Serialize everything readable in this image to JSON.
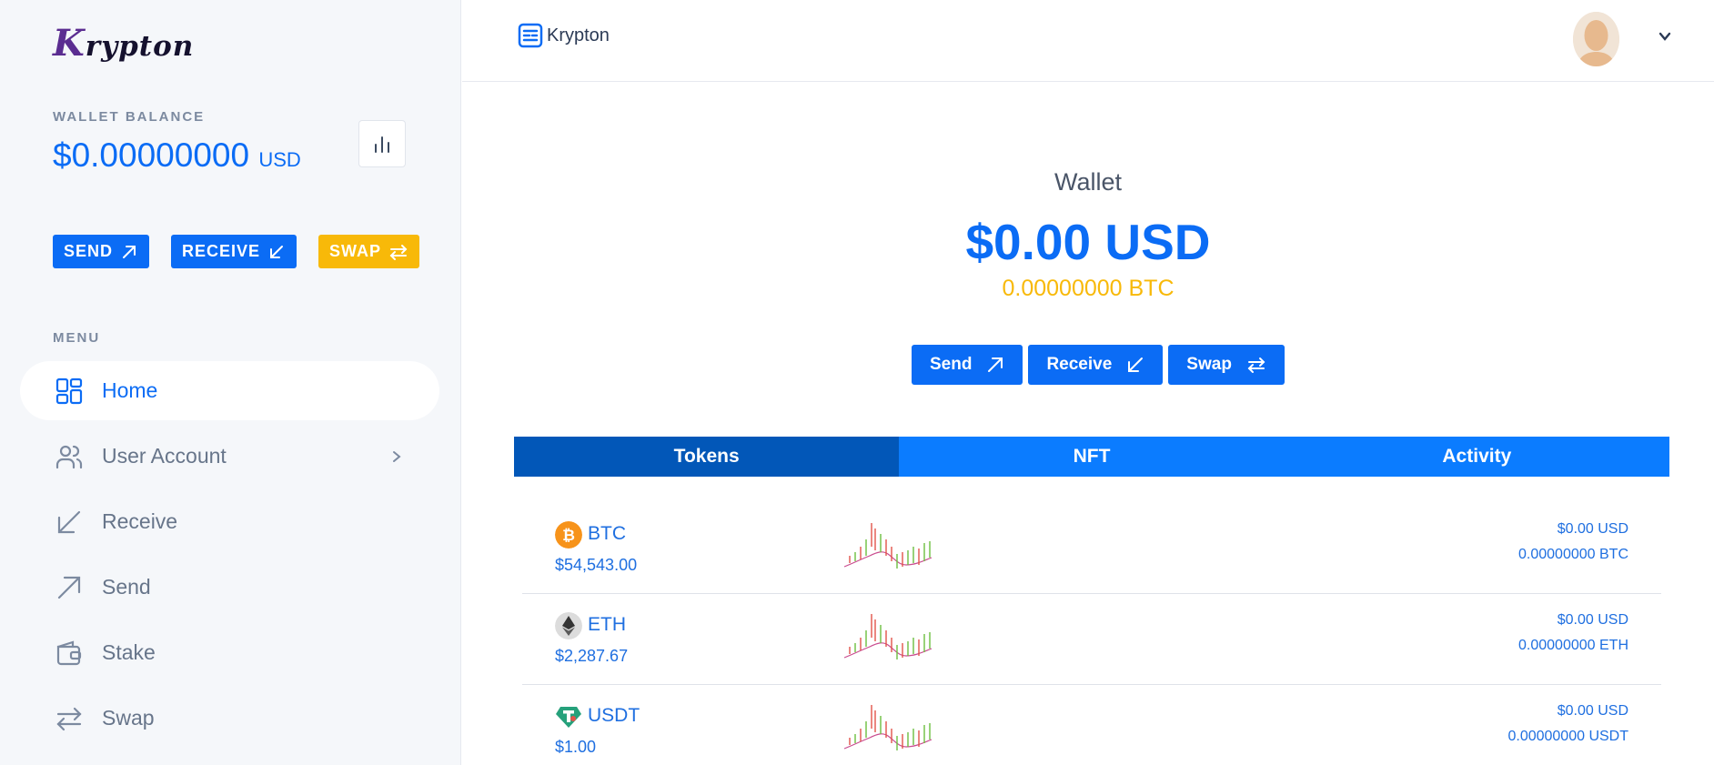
{
  "brand": {
    "logo_k": "K",
    "logo_rest": "rypton",
    "header_name": "Krypton"
  },
  "sidebar": {
    "wallet_balance_label": "WALLET BALANCE",
    "wallet_balance_value": "$0.00000000",
    "wallet_balance_unit": "USD",
    "actions": {
      "send": "SEND",
      "receive": "RECEIVE",
      "swap": "SWAP"
    },
    "menu_label": "MENU",
    "menu": [
      {
        "label": "Home",
        "icon": "grid-icon"
      },
      {
        "label": "User Account",
        "icon": "users-icon"
      },
      {
        "label": "Receive",
        "icon": "arrow-down-left-icon"
      },
      {
        "label": "Send",
        "icon": "arrow-up-right-icon"
      },
      {
        "label": "Stake",
        "icon": "wallet-icon"
      },
      {
        "label": "Swap",
        "icon": "swap-icon"
      }
    ]
  },
  "main": {
    "title": "Wallet",
    "balance_usd": "$0.00 USD",
    "balance_btc": "0.00000000 BTC",
    "actions": {
      "send": "Send",
      "receive": "Receive",
      "swap": "Swap"
    },
    "tabs": [
      "Tokens",
      "NFT",
      "Activity"
    ],
    "tokens": [
      {
        "symbol": "BTC",
        "price": "$54,543.00",
        "usd": "$0.00 USD",
        "amount": "0.00000000 BTC",
        "color": "#f7931a"
      },
      {
        "symbol": "ETH",
        "price": "$2,287.67",
        "usd": "$0.00 USD",
        "amount": "0.00000000 ETH",
        "color": "#d9d9d9"
      },
      {
        "symbol": "USDT",
        "price": "$1.00",
        "usd": "$0.00 USD",
        "amount": "0.00000000 USDT",
        "color": "#26a17b"
      }
    ]
  },
  "colors": {
    "primary": "#0b6cf5",
    "accent": "#f8b909",
    "tab_active": "#0257b8"
  }
}
